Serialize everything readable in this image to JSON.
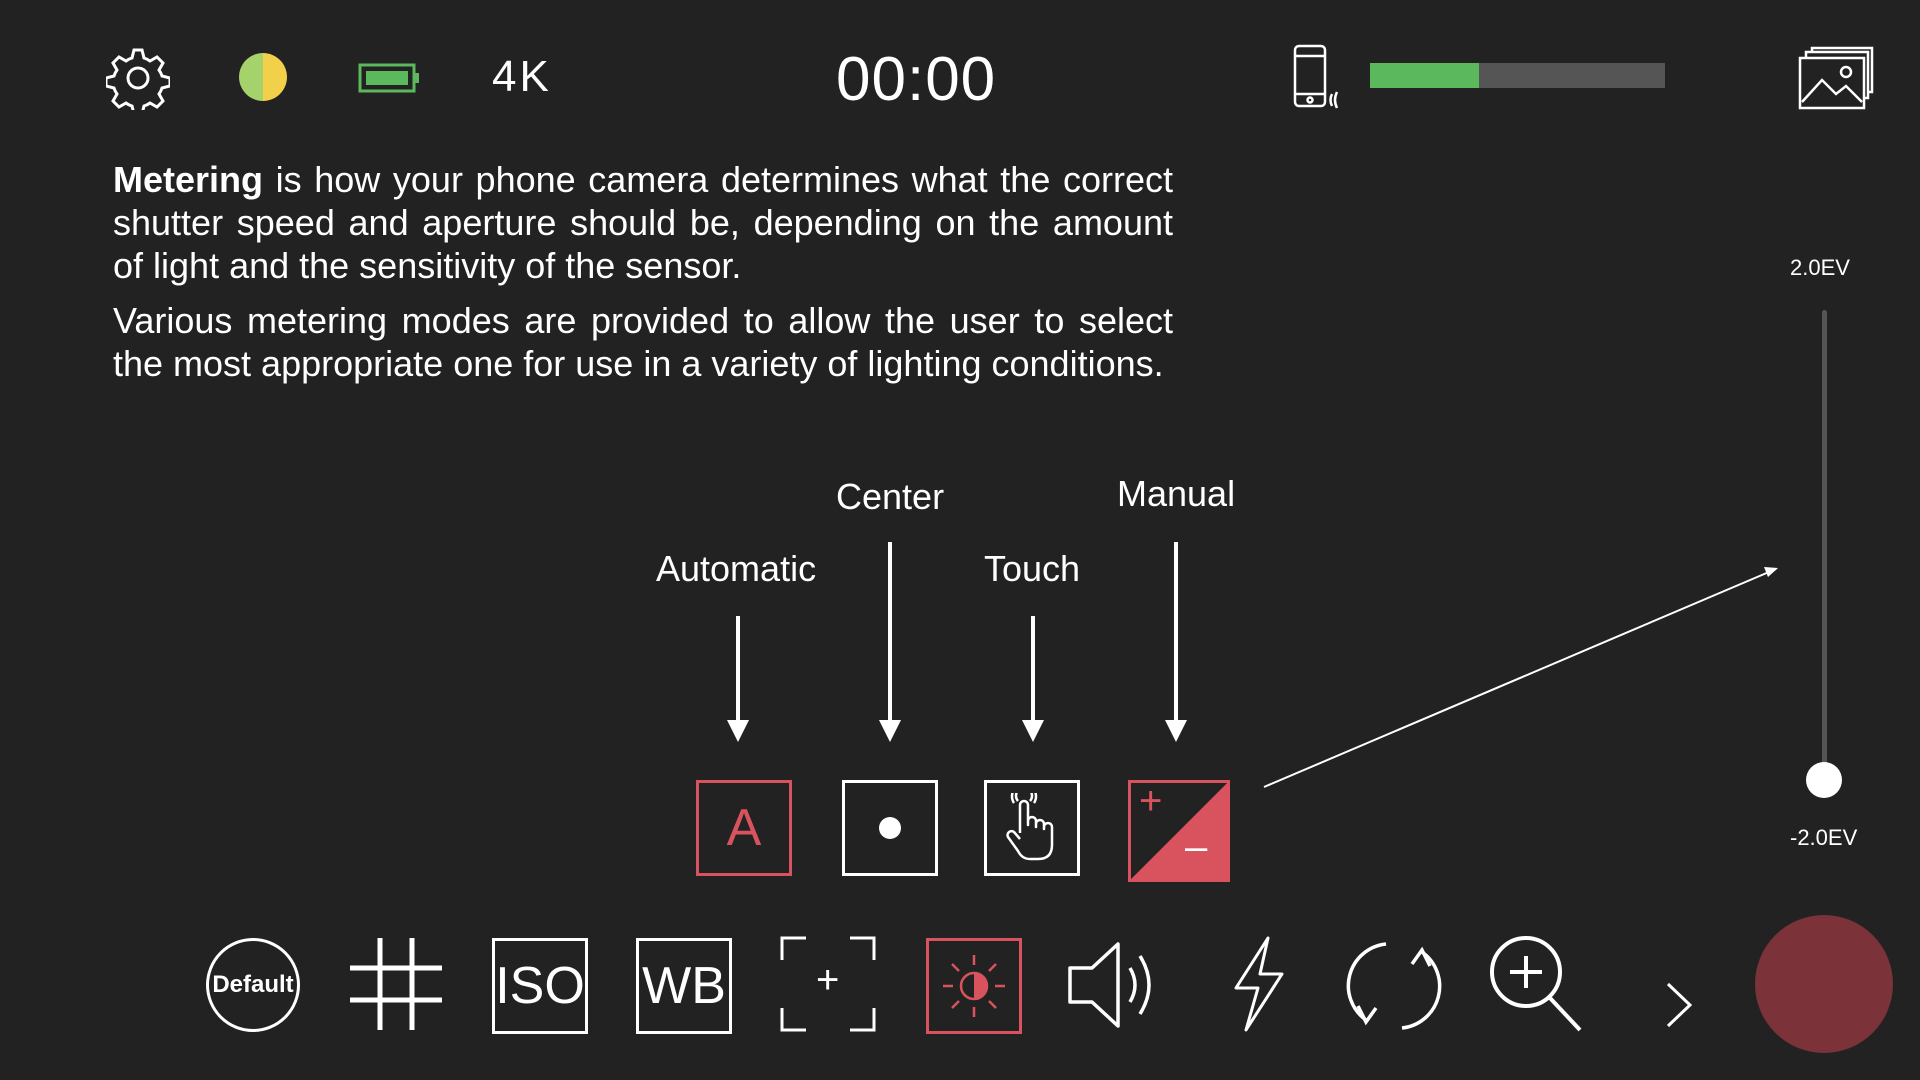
{
  "topbar": {
    "settings_icon": "gear-icon",
    "filter_icon": "color-filter-icon",
    "battery_icon": "battery-icon",
    "resolution": "4K",
    "timer": "00:00",
    "device_icon": "phone-vibrate-icon",
    "storage_level_percent": 37,
    "storage_color": "#5cb85c",
    "gallery_icon": "gallery-icon"
  },
  "description": {
    "p1_bold": "Metering",
    "p1_rest": " is how your phone camera determines what the correct shutter speed and aperture should be, depending on the amount of light and the sensitivity of the sensor.",
    "p2": "Various metering modes are provided to allow the user to select the most appropriate one for use in a variety of lighting conditions."
  },
  "metering_modes": {
    "automatic": {
      "label": "Automatic",
      "glyph": "A"
    },
    "center": {
      "label": "Center"
    },
    "touch": {
      "label": "Touch"
    },
    "manual": {
      "label": "Manual",
      "plus": "+",
      "minus": "–"
    }
  },
  "ev_slider": {
    "max_label": "2.0EV",
    "min_label": "-2.0EV",
    "value": -2.0
  },
  "toolbar": {
    "default_label": "Default",
    "iso_label": "ISO",
    "wb_label": "WB",
    "focus_plus": "+"
  },
  "colors": {
    "accent": "#d9535f",
    "record": "#7b3339",
    "background": "#222222"
  }
}
